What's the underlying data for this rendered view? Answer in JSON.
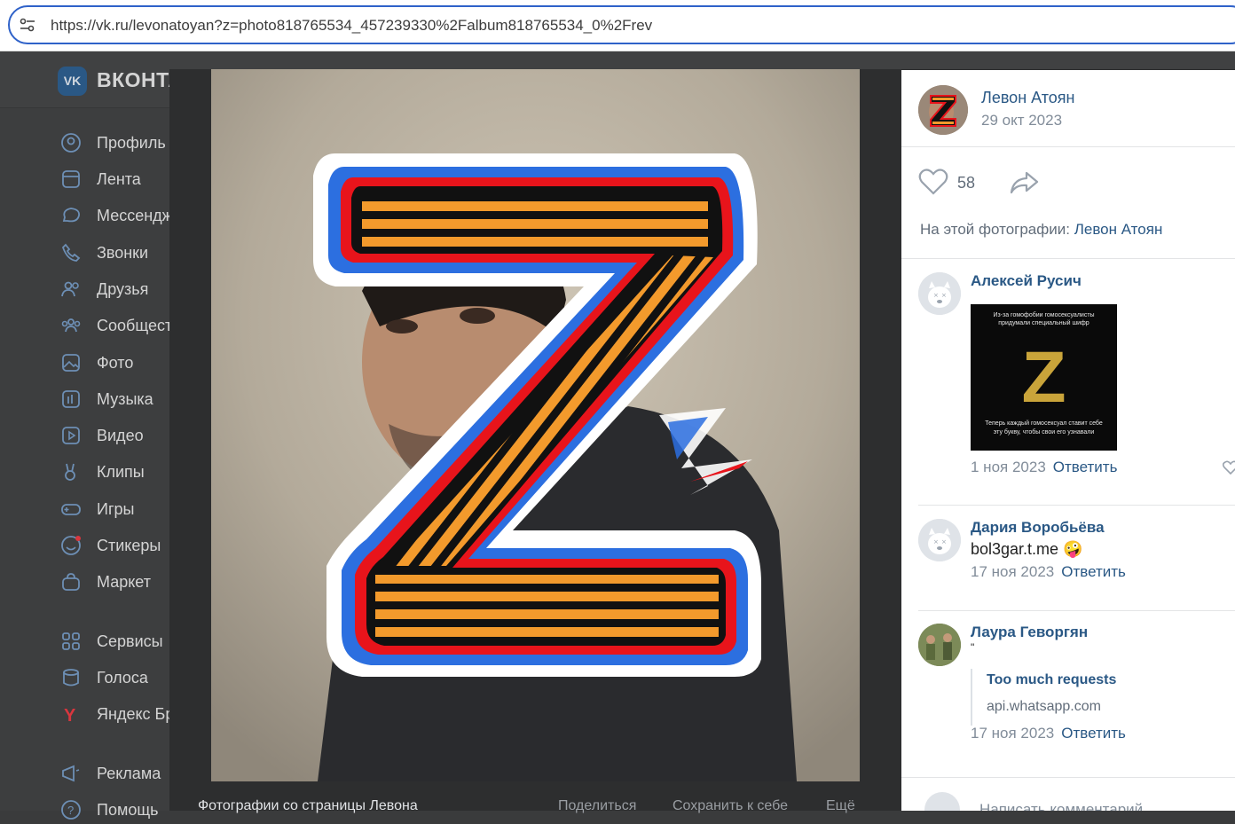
{
  "browser": {
    "url": "https://vk.ru/levonatoyan?z=photo818765534_457239330%2Falbum818765534_0%2Frev"
  },
  "vk": {
    "brand": "ВКОНТАКТЕ",
    "logo": "VK",
    "menu": [
      {
        "label": "Профиль",
        "icon": "profile-icon"
      },
      {
        "label": "Лента",
        "icon": "feed-icon"
      },
      {
        "label": "Мессенджер",
        "icon": "messenger-icon"
      },
      {
        "label": "Звонки",
        "icon": "phone-icon"
      },
      {
        "label": "Друзья",
        "icon": "friends-icon"
      },
      {
        "label": "Сообщества",
        "icon": "communities-icon"
      },
      {
        "label": "Фото",
        "icon": "photo-icon"
      },
      {
        "label": "Музыка",
        "icon": "music-icon"
      },
      {
        "label": "Видео",
        "icon": "video-icon"
      },
      {
        "label": "Клипы",
        "icon": "clips-icon"
      },
      {
        "label": "Игры",
        "icon": "games-icon"
      },
      {
        "label": "Стикеры",
        "icon": "stickers-icon"
      },
      {
        "label": "Маркет",
        "icon": "market-icon"
      },
      {
        "label": "Сервисы",
        "icon": "services-icon"
      },
      {
        "label": "Голоса",
        "icon": "votes-icon"
      },
      {
        "label": "Яндекс Браузер",
        "icon": "yandex-icon"
      },
      {
        "label": "Реклама",
        "icon": "ads-icon"
      },
      {
        "label": "Помощь",
        "icon": "help-icon"
      }
    ]
  },
  "viewer": {
    "caption": "Фотографии со страницы Левона",
    "actions": [
      "Поделиться",
      "Сохранить к себе",
      "Ещё"
    ]
  },
  "panel": {
    "owner_name": "Левон Атоян",
    "owner_date": "29 окт 2023",
    "likes": "58",
    "on_photo_label": "На этой фотографии:",
    "on_photo_person": "Левон Атоян",
    "reply_label": "Ответить",
    "comments": [
      {
        "name": "Алексей Русич",
        "date": "1 ноя 2023",
        "image_lines": [
          "Из-за гомофобии гомосексуалисты",
          "придумали специальный шифр",
          "Теперь каждый гомосексуал ставит себе",
          "эту букву, чтобы свои его узнавали"
        ],
        "image_letter": "Z"
      },
      {
        "name": "Дария Воробьёва",
        "text": "bol3gar.t.me 🤪",
        "date": "17 ноя 2023"
      },
      {
        "name": "Лаура Геворгян",
        "text": "\"",
        "link_title": "Too much requests",
        "link_domain": "api.whatsapp.com",
        "date": "17 ноя 2023"
      }
    ],
    "composer_placeholder": "Написать комментарий..."
  },
  "colors": {
    "accent": "#2a5885",
    "ribbon_orange": "#f39a2c",
    "flag_blue": "#2c6fe0",
    "flag_red": "#e8141b"
  }
}
